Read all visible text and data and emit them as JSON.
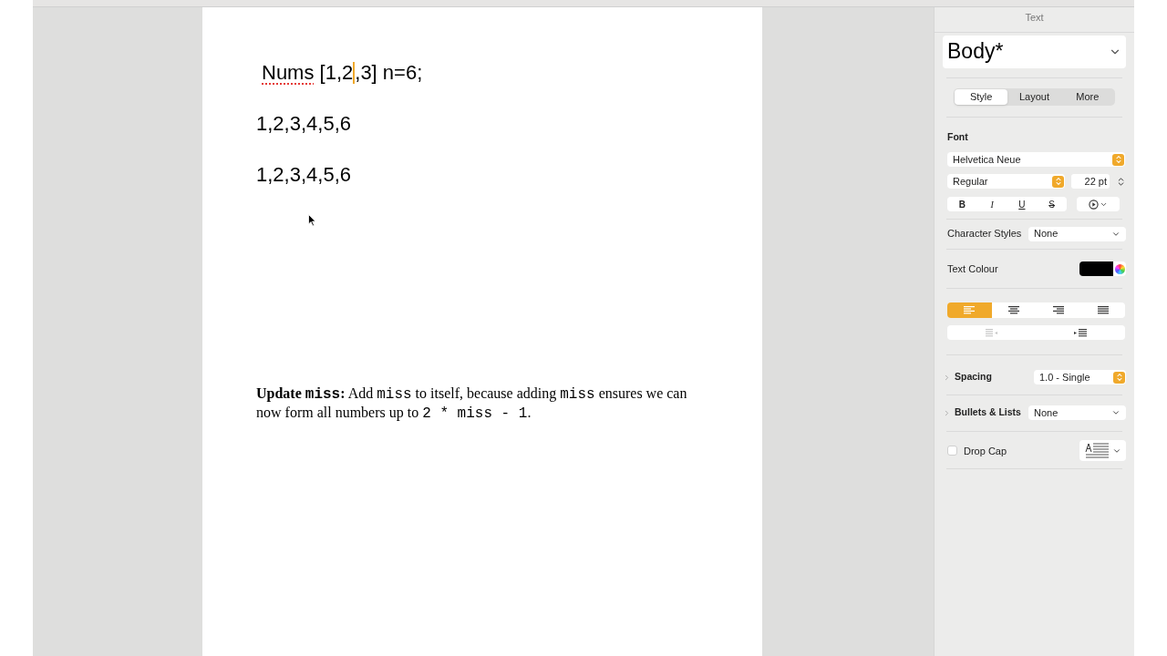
{
  "document": {
    "heading": [
      {
        "kind": "text",
        "text": "Nums",
        "misspelled": true
      },
      {
        "kind": "text",
        "text": " [1,2",
        "misspelled": false
      },
      {
        "kind": "cursor"
      },
      {
        "kind": "text",
        "text": ",3] n=6;",
        "misspelled": false
      }
    ],
    "lines": [
      "1,2,3,4,5,6",
      "1,2,3,4,5,6"
    ],
    "paragraph": [
      {
        "kind": "bold",
        "text": "Update "
      },
      {
        "kind": "bold_code",
        "text": "miss"
      },
      {
        "kind": "bold",
        "text": ":"
      },
      {
        "kind": "text",
        "text": " Add "
      },
      {
        "kind": "code",
        "text": "miss"
      },
      {
        "kind": "text",
        "text": " to itself, because adding "
      },
      {
        "kind": "code",
        "text": "miss"
      },
      {
        "kind": "text",
        "text": " ensures we can now form all numbers up to "
      },
      {
        "kind": "code",
        "text": "2 * miss - 1"
      },
      {
        "kind": "text",
        "text": "."
      }
    ]
  },
  "inspector": {
    "title": "Text",
    "style_name": "Body*",
    "tabs": [
      {
        "label": "Style",
        "selected": true
      },
      {
        "label": "Layout",
        "selected": false
      },
      {
        "label": "More",
        "selected": false
      }
    ],
    "font_label": "Font",
    "font_family": "Helvetica Neue",
    "typeface": "Regular",
    "size": "22 pt",
    "format_buttons": [
      {
        "kind": "bold",
        "label": "B",
        "on": false
      },
      {
        "kind": "italic",
        "label": "I",
        "on": false
      },
      {
        "kind": "underline",
        "label": "U",
        "on": false
      },
      {
        "kind": "strike",
        "label": "S",
        "on": false
      }
    ],
    "character_styles": {
      "label": "Character Styles",
      "value": "None"
    },
    "text_colour": {
      "label": "Text Colour",
      "color": "#000000"
    },
    "alignment": [
      {
        "kind": "left",
        "selected": true
      },
      {
        "kind": "center",
        "selected": false
      },
      {
        "kind": "right",
        "selected": false
      },
      {
        "kind": "justify",
        "selected": false
      }
    ],
    "indent": [
      {
        "kind": "decrease",
        "disabled": true
      },
      {
        "kind": "increase",
        "disabled": false
      }
    ],
    "spacing": {
      "label": "Spacing",
      "value": "1.0 - Single"
    },
    "bullets": {
      "label": "Bullets & Lists",
      "value": "None"
    },
    "drop_cap": {
      "label": "Drop Cap",
      "checked": false
    }
  }
}
